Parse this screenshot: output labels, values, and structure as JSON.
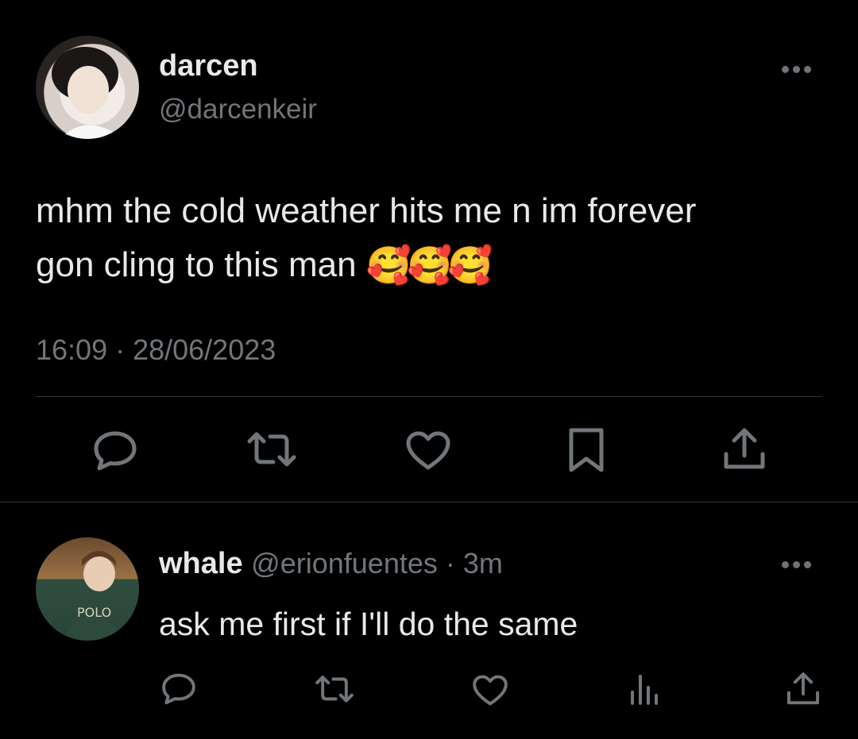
{
  "tweet": {
    "display_name": "darcen",
    "handle": "@darcenkeir",
    "text_line1": "mhm the cold weather hits me n im forever",
    "text_line2": "gon cling to this man ",
    "emoji": "🥰🥰🥰",
    "timestamp": "16:09 · 28/06/2023",
    "actions": [
      "reply-icon",
      "retweet-icon",
      "like-icon",
      "bookmark-icon",
      "share-icon"
    ]
  },
  "reply": {
    "display_name": "whale",
    "handle": "@erionfuentes",
    "time": " · 3m",
    "text": "ask me first if I'll do the same",
    "actions": [
      "reply-icon",
      "retweet-icon",
      "like-icon",
      "views-icon",
      "share-icon"
    ]
  },
  "colors": {
    "background": "#000000",
    "text": "#e7e9ea",
    "muted": "#71767b",
    "divider": "#2f3336"
  }
}
